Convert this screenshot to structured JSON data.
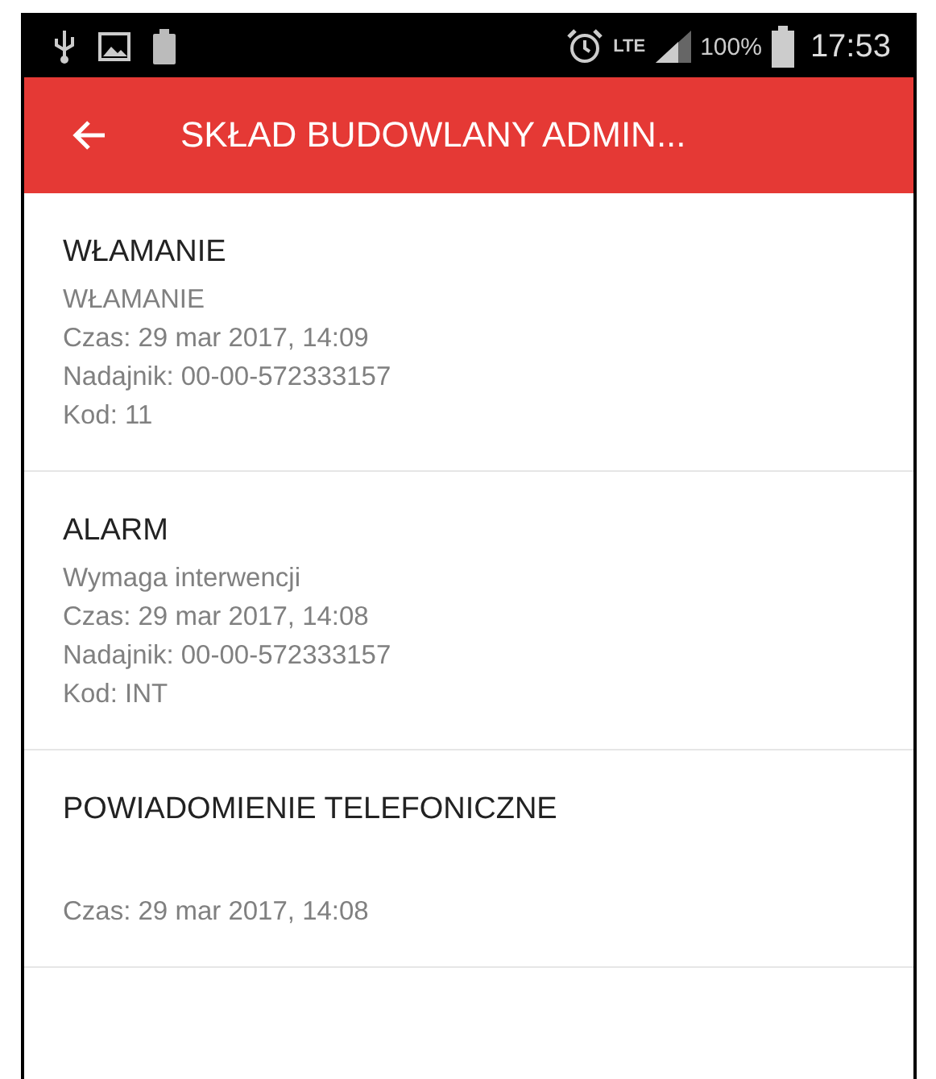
{
  "status_bar": {
    "network": "LTE",
    "battery": "100%",
    "time": "17:53"
  },
  "app_bar": {
    "title": "SKŁAD BUDOWLANY ADMIN..."
  },
  "events": [
    {
      "title": "WŁAMANIE",
      "subtitle": "WŁAMANIE",
      "details": [
        "Czas: 29 mar 2017, 14:09",
        "Nadajnik: 00-00-572333157",
        "Kod: 11"
      ]
    },
    {
      "title": "ALARM",
      "subtitle": "Wymaga interwencji",
      "details": [
        "Czas: 29 mar 2017, 14:08",
        "Nadajnik: 00-00-572333157",
        "Kod: INT"
      ]
    },
    {
      "title": "POWIADOMIENIE TELEFONICZNE",
      "details": [
        "Czas: 29 mar 2017, 14:08"
      ]
    }
  ]
}
